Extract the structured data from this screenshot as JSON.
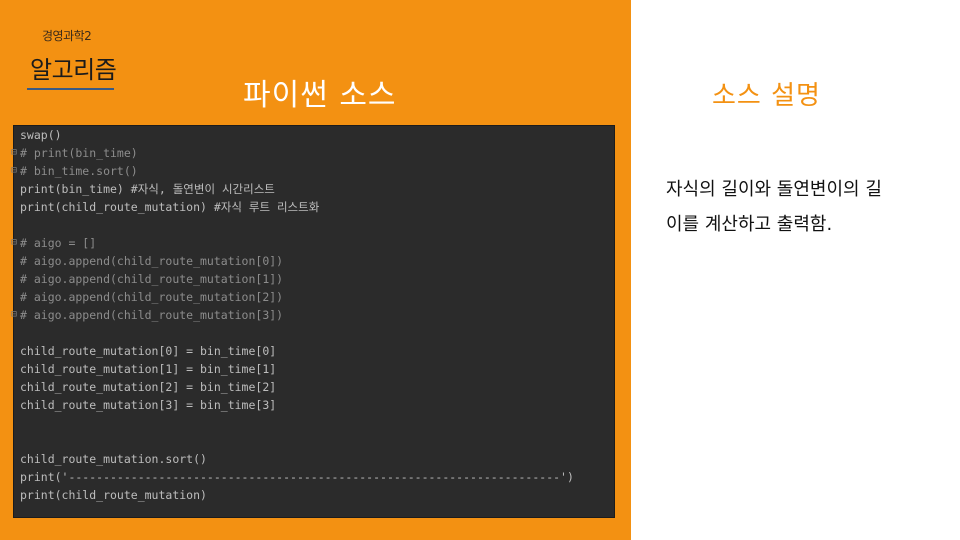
{
  "slide": {
    "course": "경영과학2",
    "subject": "알고리즘",
    "left_title": "파이썬 소스",
    "right_title": "소스 설명",
    "description_line1": "자식의 길이와 돌연변이의 길",
    "description_line2": "이를 계산하고 출력함."
  },
  "code": {
    "lines": [
      "swap()",
      "# print(bin_time)",
      "# bin_time.sort()",
      "print(bin_time) #자식, 돌연변이 시간리스트",
      "print(child_route_mutation) #자식 루트 리스트화",
      "",
      "# aigo = []",
      "# aigo.append(child_route_mutation[0])",
      "# aigo.append(child_route_mutation[1])",
      "# aigo.append(child_route_mutation[2])",
      "# aigo.append(child_route_mutation[3])",
      "",
      "child_route_mutation[0] = bin_time[0]",
      "child_route_mutation[1] = bin_time[1]",
      "child_route_mutation[2] = bin_time[2]",
      "child_route_mutation[3] = bin_time[3]",
      "",
      "",
      "child_route_mutation.sort()",
      "print('-----------------------------------------------------------------------')",
      "print(child_route_mutation)"
    ]
  },
  "colors": {
    "accent_orange": "#f39112",
    "code_background": "#2b2b2b",
    "code_text": "#bdbdbd",
    "comment": "#8c8c8c",
    "builtin": "#9da3e6"
  }
}
